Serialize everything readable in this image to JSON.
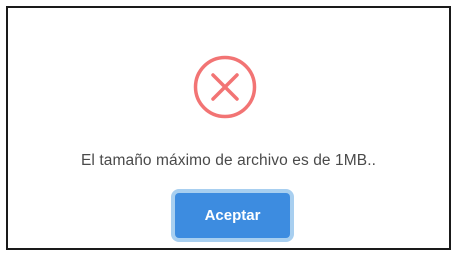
{
  "dialog": {
    "icon": "error-x-circle-icon",
    "icon_color": "#f27474",
    "message": "El tamaño máximo de archivo es de 1MB..",
    "confirm_label": "Aceptar",
    "confirm_color": "#3d8ce0"
  }
}
